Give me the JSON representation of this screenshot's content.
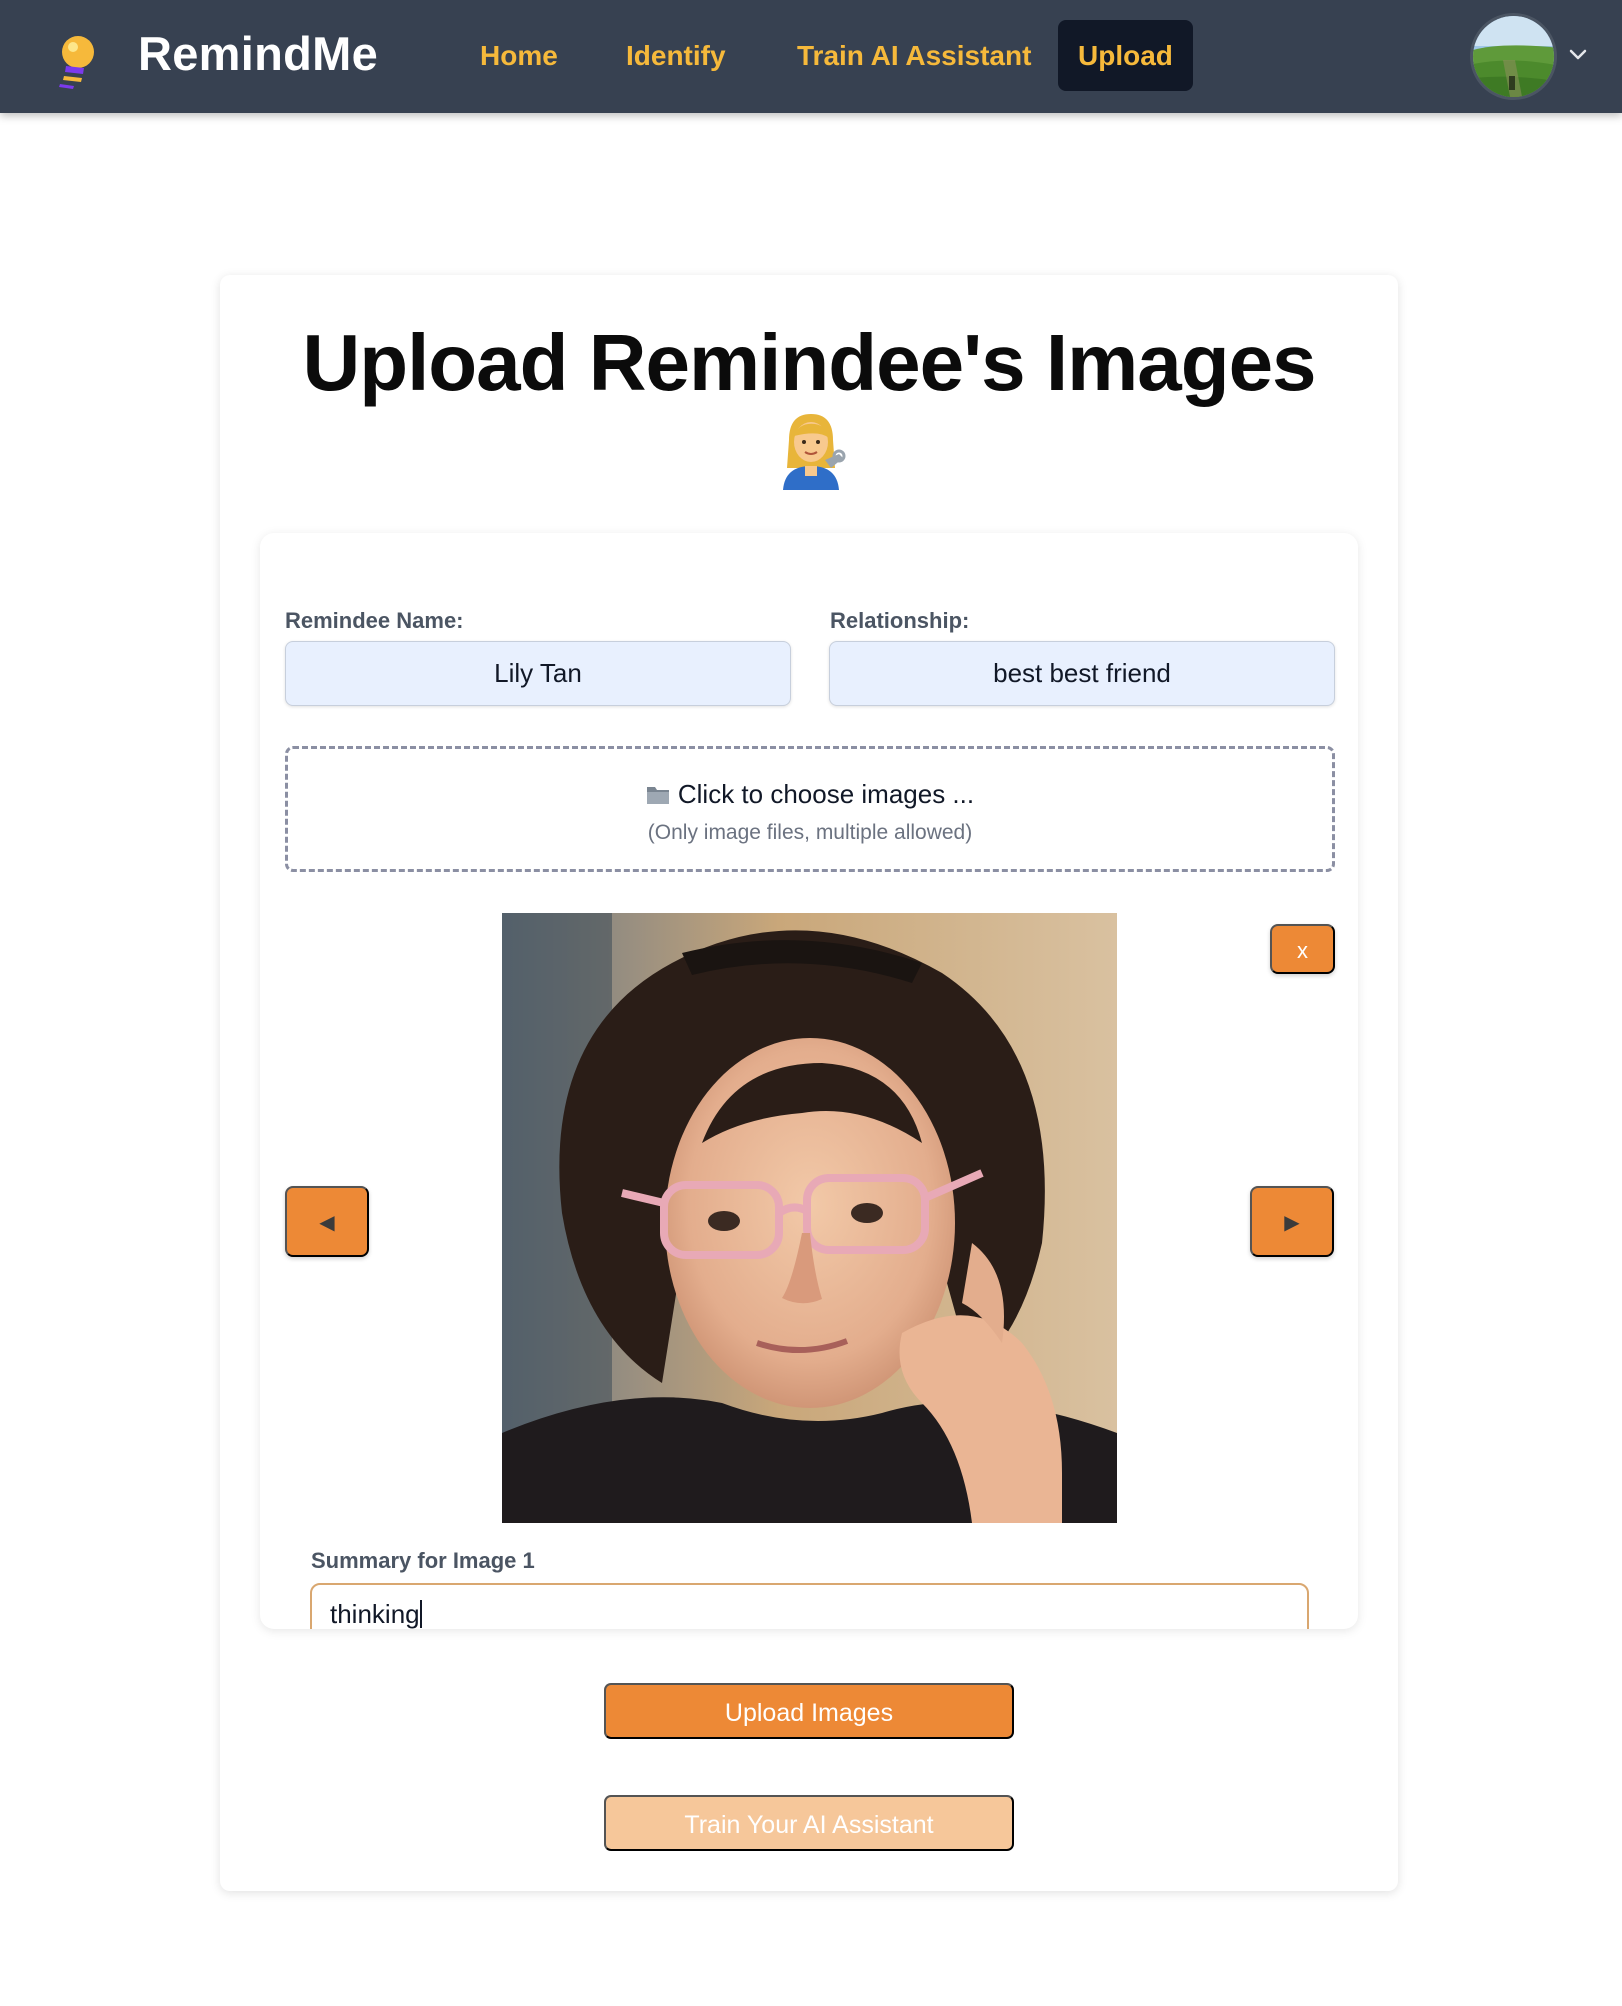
{
  "app": {
    "brand": "RemindMe",
    "logo_icon": "lightbulb-icon"
  },
  "nav": {
    "items": [
      {
        "label": "Home",
        "active": false
      },
      {
        "label": "Identify",
        "active": false
      },
      {
        "label": "Train AI Assistant",
        "active": false
      },
      {
        "label": "Upload",
        "active": true
      }
    ],
    "avatar_icon": "user-avatar",
    "menu_icon": "chevron-down-icon"
  },
  "page": {
    "title": "Upload Remindee's Images",
    "title_emoji_icon": "woman-mechanic-emoji-icon"
  },
  "form": {
    "name_label": "Remindee Name:",
    "name_value": "Lily Tan",
    "relationship_label": "Relationship:",
    "relationship_value": "best best friend",
    "dropzone_icon": "folder-icon",
    "dropzone_text": "Click to choose images ...",
    "dropzone_hint": "(Only image files, multiple allowed)",
    "remove_label": "x",
    "prev_label": "◀",
    "next_label": "▶",
    "summary_label": "Summary for Image 1",
    "summary_value": "thinking"
  },
  "actions": {
    "upload_label": "Upload Images",
    "train_label": "Train Your AI Assistant"
  },
  "colors": {
    "navbar": "#374151",
    "nav_link": "#f6b93b",
    "nav_active_bg": "#111827",
    "accent": "#ed8936",
    "accent_disabled": "#f6c79a",
    "input_bg": "#e8f0fe"
  }
}
